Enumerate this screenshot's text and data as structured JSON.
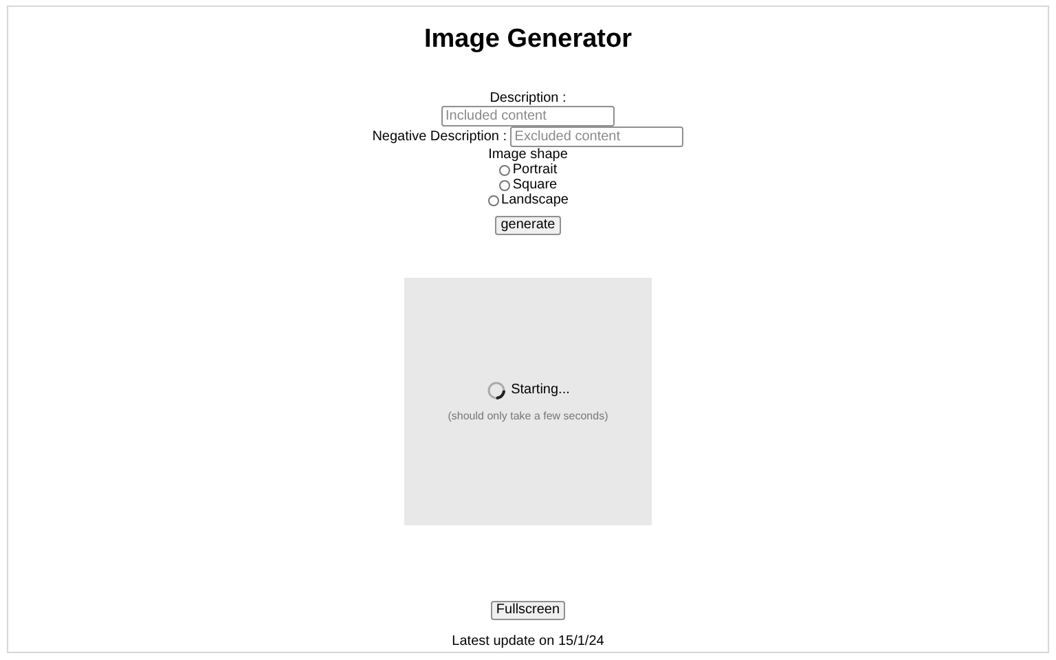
{
  "title": "Image Generator",
  "description": {
    "label": "Description :",
    "placeholder": "Included content"
  },
  "negative_description": {
    "label": "Negative Description :",
    "placeholder": "Excluded content"
  },
  "image_shape": {
    "label": "Image shape",
    "options": [
      {
        "label": "Portrait",
        "selected": false
      },
      {
        "label": "Square",
        "selected": false
      },
      {
        "label": "Landscape",
        "selected": false
      }
    ]
  },
  "generate_button": "generate",
  "preview": {
    "status": "Starting...",
    "note": "(should only take a few seconds)"
  },
  "fullscreen_button": "Fullscreen",
  "footer": "Latest update on 15/1/24"
}
